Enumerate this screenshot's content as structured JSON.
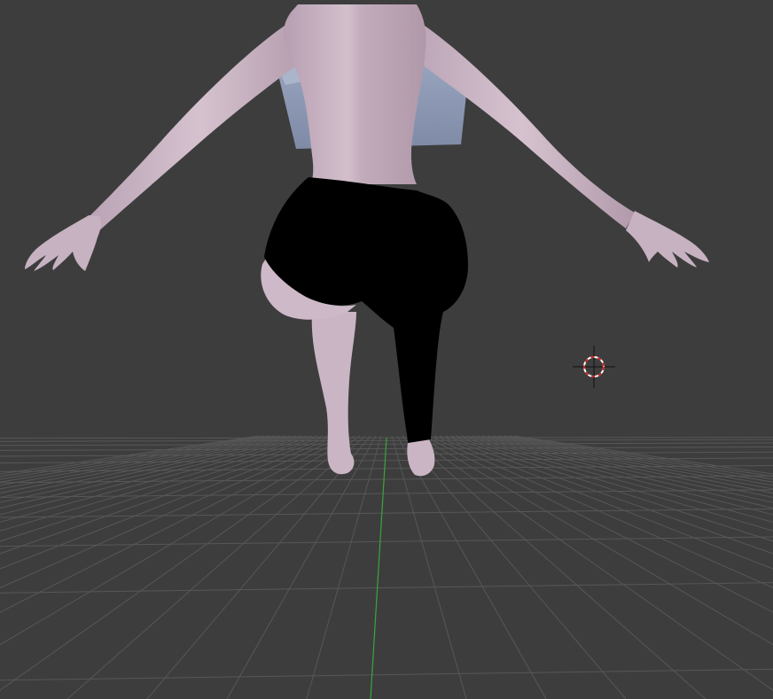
{
  "app": {
    "name": "3D viewport",
    "view": "perspective"
  },
  "viewport": {
    "background_color": "#3d3d3d",
    "grid_color": "#555555",
    "y_axis_color": "#3aa63a",
    "grid_visible": true
  },
  "scene": {
    "objects": [
      {
        "name": "cube",
        "icon": "cube-mesh",
        "color": "#8a98b6"
      },
      {
        "name": "character",
        "icon": "human-mesh",
        "skin_color": "#c9b4c3",
        "clothing_color": "#000000"
      }
    ],
    "cursor": {
      "icon": "3d-cursor-icon",
      "ring_colors": [
        "#cc2222",
        "#ffffff"
      ]
    }
  }
}
